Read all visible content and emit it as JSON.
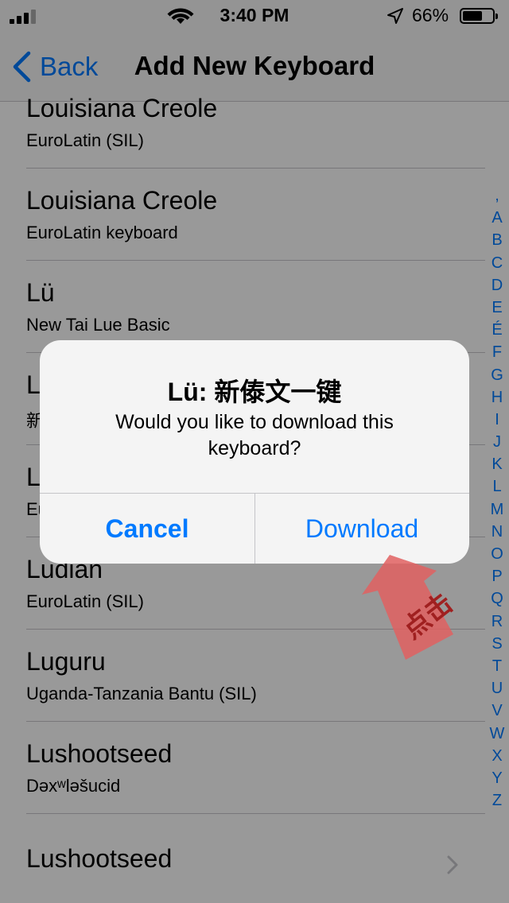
{
  "status_bar": {
    "time": "3:40 PM",
    "battery_percent": "66%",
    "battery_level": 0.66,
    "signal_bars": 3,
    "signal_total": 4
  },
  "nav": {
    "back_label": "Back",
    "title": "Add New Keyboard"
  },
  "list": [
    {
      "name": "Louisiana Creole",
      "subtitle": "EuroLatin (SIL)"
    },
    {
      "name": "Louisiana Creole",
      "subtitle": "EuroLatin keyboard"
    },
    {
      "name": "Lü",
      "subtitle": "New Tai Lue Basic"
    },
    {
      "name": "L",
      "subtitle": "新"
    },
    {
      "name": "L",
      "subtitle": "Eu"
    },
    {
      "name": "Ludian",
      "subtitle": "EuroLatin (SIL)"
    },
    {
      "name": "Luguru",
      "subtitle": "Uganda-Tanzania Bantu (SIL)"
    },
    {
      "name": "Lushootseed",
      "subtitle": "Dəxʷləšucid"
    },
    {
      "name": "Lushootseed",
      "subtitle": ""
    }
  ],
  "index_letters": [
    ",",
    "A",
    "B",
    "C",
    "D",
    "E",
    "É",
    "F",
    "G",
    "H",
    "I",
    "J",
    "K",
    "L",
    "M",
    "N",
    "O",
    "P",
    "Q",
    "R",
    "S",
    "T",
    "U",
    "V",
    "W",
    "X",
    "Y",
    "Z"
  ],
  "alert": {
    "title": "Lü: 新傣文一键",
    "message": "Would you like to download this keyboard?",
    "cancel_label": "Cancel",
    "download_label": "Download"
  },
  "annotation": {
    "text": "点击",
    "color": "#e06060"
  },
  "colors": {
    "accent": "#007aff"
  }
}
